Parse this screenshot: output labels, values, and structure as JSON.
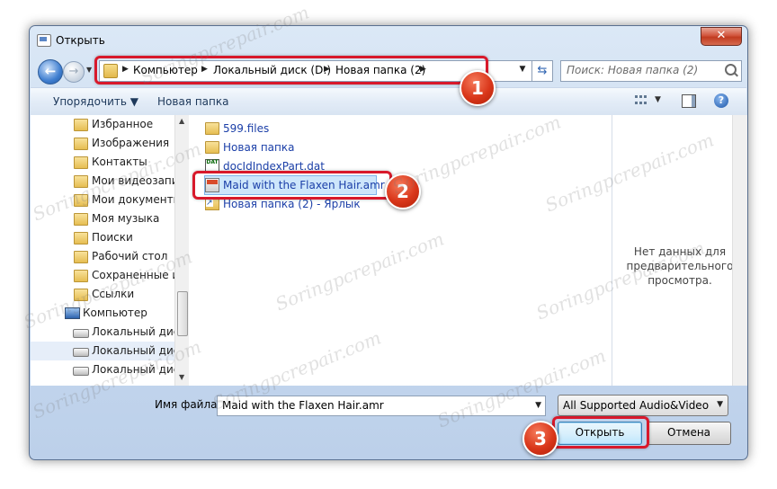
{
  "window": {
    "title": "Открыть",
    "close_glyph": "✕"
  },
  "address": {
    "crumbs": [
      "Компьютер",
      "Локальный диск (D:)",
      "Новая папка (2)"
    ],
    "search_placeholder": "Поиск: Новая папка (2)"
  },
  "toolbar": {
    "organize": "Упорядочить ▼",
    "new_folder": "Новая папка"
  },
  "nav": {
    "items": [
      {
        "label": "Избранное",
        "icon": "folder-icon"
      },
      {
        "label": "Изображения",
        "icon": "folder-icon"
      },
      {
        "label": "Контакты",
        "icon": "folder-icon"
      },
      {
        "label": "Мои видеозаписи",
        "icon": "folder-icon"
      },
      {
        "label": "Мои документы",
        "icon": "folder-icon"
      },
      {
        "label": "Моя музыка",
        "icon": "folder-icon"
      },
      {
        "label": "Поиски",
        "icon": "folder-icon"
      },
      {
        "label": "Рабочий стол",
        "icon": "folder-icon"
      },
      {
        "label": "Сохраненные игры",
        "icon": "folder-icon"
      },
      {
        "label": "Ссылки",
        "icon": "folder-icon"
      },
      {
        "label": "Компьютер",
        "icon": "computer-icon"
      },
      {
        "label": "Локальный диск (C:)",
        "icon": "drive-icon"
      },
      {
        "label": "Локальный диск (D:)",
        "icon": "drive-icon"
      },
      {
        "label": "Локальный диск (E:)",
        "icon": "drive-icon"
      }
    ]
  },
  "files": {
    "items": [
      {
        "label": "599.files",
        "icon": "folder-icon"
      },
      {
        "label": "Новая папка",
        "icon": "folder-icon"
      },
      {
        "label": "docIdIndexPart.dat",
        "icon": "dat-file-icon"
      },
      {
        "label": "Maid with the Flaxen Hair.amr",
        "icon": "amr-file-icon",
        "selected": true
      },
      {
        "label": "Новая папка (2) - Ярлык",
        "icon": "shortcut-icon"
      }
    ]
  },
  "preview": {
    "lines": [
      "Нет данных для",
      "предварительного",
      "просмотра."
    ]
  },
  "bottom": {
    "filename_label": "Имя файла:",
    "filename_value": "Maid with the Flaxen Hair.amr",
    "filter_value": "All Supported Audio&Video Files",
    "open_label": "Открыть",
    "cancel_label": "Отмена"
  },
  "annotations": {
    "badge1": "1",
    "badge2": "2",
    "badge3": "3"
  },
  "watermark": "Soringpcrepair.com",
  "colors": {
    "highlight": "#d8192b",
    "badge": "#d9361a",
    "link_text": "#1b3fa8"
  }
}
